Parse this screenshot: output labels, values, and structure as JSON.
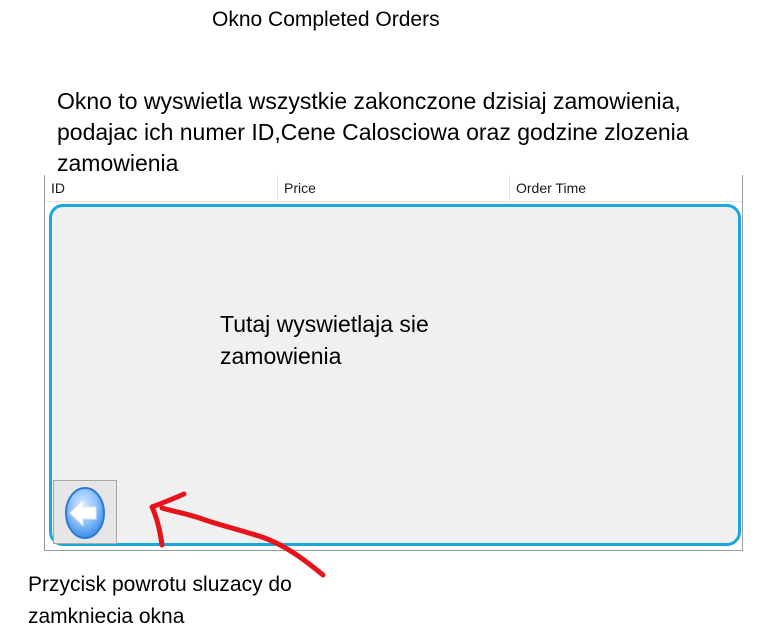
{
  "window_title": "Okno Completed Orders",
  "description": "Okno to wyswietla wszystkie zakonczone dzisiaj zamowienia, podajac ich numer ID,Cene Calosciowa oraz godzine zlozenia zamowienia",
  "orders_table": {
    "columns": [
      "ID",
      "Price",
      "Order Time"
    ],
    "placeholder": "Tutaj wyswietlaja sie zamowienia"
  },
  "back_button": {
    "icon": "back-arrow-icon"
  },
  "annotation": {
    "back_note": "Przycisk powrotu sluzacy do zamkniecia okna",
    "accent_color": "#e8121b",
    "highlight_color": "#1aa7e0"
  }
}
